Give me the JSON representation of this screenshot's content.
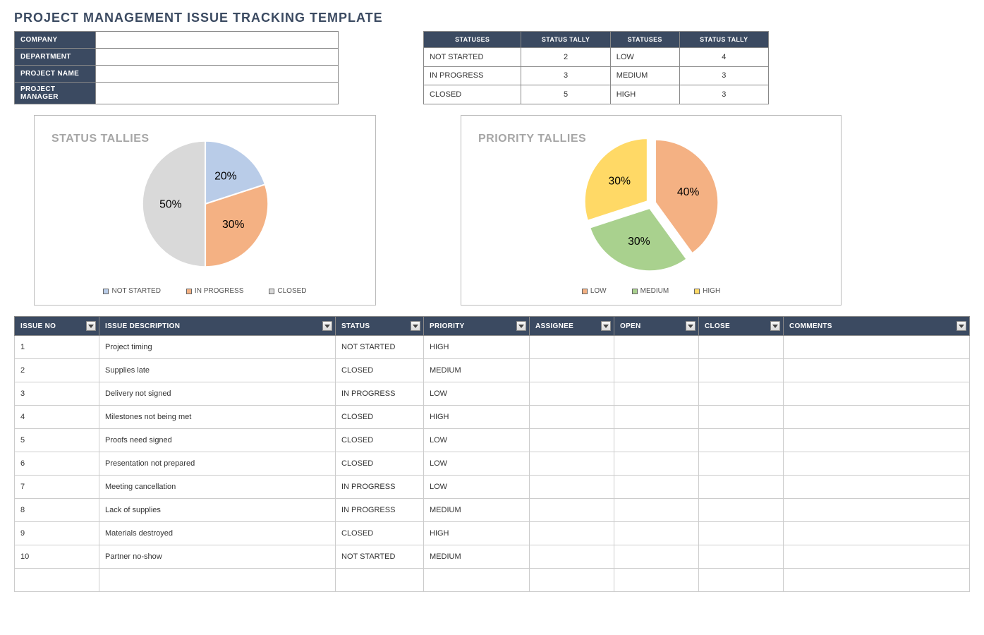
{
  "title": "PROJECT MANAGEMENT ISSUE TRACKING TEMPLATE",
  "meta": {
    "labels": [
      "COMPANY",
      "DEPARTMENT",
      "PROJECT NAME",
      "PROJECT MANAGER"
    ],
    "values": [
      "",
      "",
      "",
      ""
    ]
  },
  "tally": {
    "headers": [
      "STATUSES",
      "STATUS TALLY",
      "STATUSES",
      "STATUS TALLY"
    ],
    "rows": [
      [
        "NOT STARTED",
        "2",
        "LOW",
        "4"
      ],
      [
        "IN PROGRESS",
        "3",
        "MEDIUM",
        "3"
      ],
      [
        "CLOSED",
        "5",
        "HIGH",
        "3"
      ]
    ]
  },
  "chart_data": [
    {
      "type": "pie",
      "title": "STATUS TALLIES",
      "categories": [
        "NOT STARTED",
        "IN PROGRESS",
        "CLOSED"
      ],
      "values": [
        20,
        30,
        50
      ],
      "labels": [
        "20%",
        "30%",
        "50%"
      ],
      "colors": [
        "#B9CCE8",
        "#F4B183",
        "#D9D9D9"
      ]
    },
    {
      "type": "pie",
      "title": "PRIORITY TALLIES",
      "categories": [
        "LOW",
        "MEDIUM",
        "HIGH"
      ],
      "values": [
        40,
        30,
        30
      ],
      "labels": [
        "40%",
        "30%",
        "30%"
      ],
      "colors": [
        "#F4B183",
        "#A9D18E",
        "#FFD966"
      ]
    }
  ],
  "issues": {
    "headers": [
      "ISSUE NO",
      "ISSUE DESCRIPTION",
      "STATUS",
      "PRIORITY",
      "ASSIGNEE",
      "OPEN",
      "CLOSE",
      "COMMENTS"
    ],
    "rows": [
      [
        "1",
        "Project timing",
        "NOT STARTED",
        "HIGH",
        "",
        "",
        "",
        ""
      ],
      [
        "2",
        "Supplies late",
        "CLOSED",
        "MEDIUM",
        "",
        "",
        "",
        ""
      ],
      [
        "3",
        "Delivery not signed",
        "IN PROGRESS",
        "LOW",
        "",
        "",
        "",
        ""
      ],
      [
        "4",
        "Milestones not being met",
        "CLOSED",
        "HIGH",
        "",
        "",
        "",
        ""
      ],
      [
        "5",
        "Proofs need signed",
        "CLOSED",
        "LOW",
        "",
        "",
        "",
        ""
      ],
      [
        "6",
        "Presentation not prepared",
        "CLOSED",
        "LOW",
        "",
        "",
        "",
        ""
      ],
      [
        "7",
        "Meeting cancellation",
        "IN PROGRESS",
        "LOW",
        "",
        "",
        "",
        ""
      ],
      [
        "8",
        "Lack of supplies",
        "IN PROGRESS",
        "MEDIUM",
        "",
        "",
        "",
        ""
      ],
      [
        "9",
        "Materials destroyed",
        "CLOSED",
        "HIGH",
        "",
        "",
        "",
        ""
      ],
      [
        "10",
        "Partner no-show",
        "NOT STARTED",
        "MEDIUM",
        "",
        "",
        "",
        ""
      ],
      [
        "",
        "",
        "",
        "",
        "",
        "",
        "",
        ""
      ]
    ]
  }
}
